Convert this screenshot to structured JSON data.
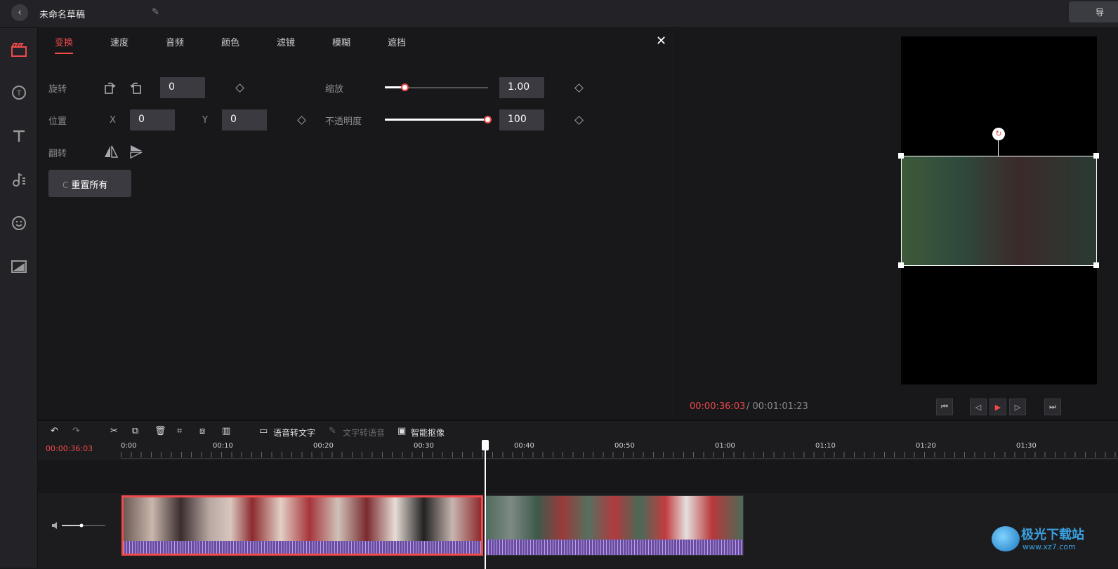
{
  "header": {
    "title": "未命名草稿",
    "export_label": "导"
  },
  "sidebar": {
    "items": [
      "media-icon",
      "sticker-icon",
      "text-icon",
      "music-icon",
      "emoji-icon",
      "image-icon"
    ]
  },
  "props": {
    "tabs": [
      "变换",
      "速度",
      "音频",
      "颜色",
      "滤镜",
      "模糊",
      "遮挡"
    ],
    "active_tab": "变换",
    "rotate_label": "旋转",
    "rotate_value": "0",
    "position_label": "位置",
    "x_label": "X",
    "x_value": "0",
    "y_label": "Y",
    "y_value": "0",
    "flip_label": "翻转",
    "scale_label": "缩放",
    "scale_value": "1.00",
    "scale_fraction": 0.2,
    "opacity_label": "不透明度",
    "opacity_value": "100",
    "opacity_fraction": 1.0,
    "reset_label": "重置所有",
    "reset_icon": "C"
  },
  "preview": {
    "current_time": "00:00:36:03",
    "total_time": "/ 00:01:01:23"
  },
  "timeline": {
    "current_time": "00:00:36:03",
    "tools": {
      "speech_to_text": "语音转文字",
      "text_to_speech": "文字转语音",
      "smart_matting": "智能抠像"
    },
    "ruler_labels": [
      "0:00",
      "00:10",
      "00:20",
      "00:30",
      "00:40",
      "00:50",
      "01:00",
      "01:10",
      "01:20",
      "01:30"
    ]
  },
  "watermark": {
    "text": "极光下载站",
    "url": "www.xz7.com"
  },
  "colors": {
    "accent": "#f04a4a",
    "panel": "#18181b",
    "field": "#3a3a40"
  }
}
